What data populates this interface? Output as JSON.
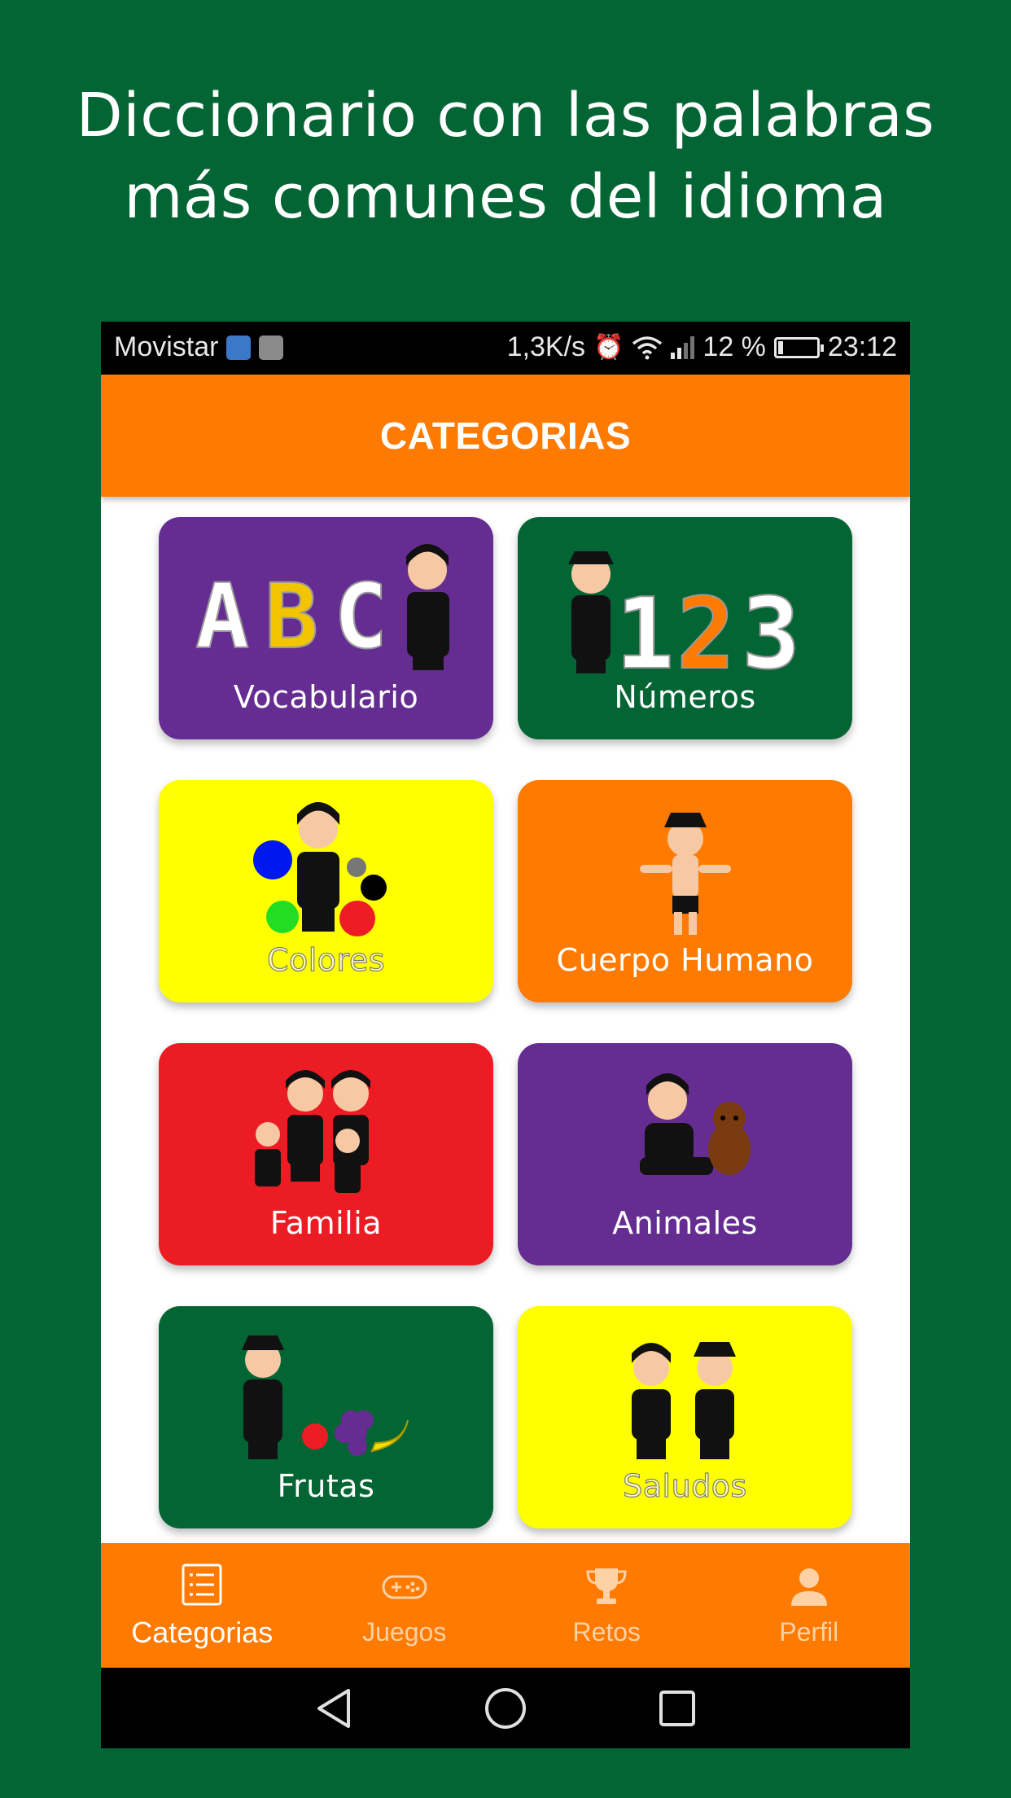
{
  "headline": {
    "line1": "Diccionario con las palabras",
    "line2": "más comunes del idioma"
  },
  "status_bar": {
    "carrier": "Movistar",
    "speed": "1,3K/s",
    "battery_percent": "12 %",
    "time": "23:12"
  },
  "app_bar": {
    "title": "CATEGORIAS"
  },
  "categories": [
    {
      "label": "Vocabulario",
      "color": "#652d91"
    },
    {
      "label": "Números",
      "color": "#046534"
    },
    {
      "label": "Colores",
      "color": "#ffff00"
    },
    {
      "label": "Cuerpo Humano",
      "color": "#fe7a00"
    },
    {
      "label": "Familia",
      "color": "#ec1c24"
    },
    {
      "label": "Animales",
      "color": "#652d91"
    },
    {
      "label": "Frutas",
      "color": "#046534"
    },
    {
      "label": "Saludos",
      "color": "#ffff00"
    }
  ],
  "bottom_nav": {
    "items": [
      {
        "label": "Categorias",
        "icon": "list-icon",
        "active": true
      },
      {
        "label": "Juegos",
        "icon": "gamepad-icon",
        "active": false
      },
      {
        "label": "Retos",
        "icon": "trophy-icon",
        "active": false
      },
      {
        "label": "Perfil",
        "icon": "person-icon",
        "active": false
      }
    ]
  },
  "colors": {
    "background": "#046534",
    "accent": "#fe7a00"
  }
}
